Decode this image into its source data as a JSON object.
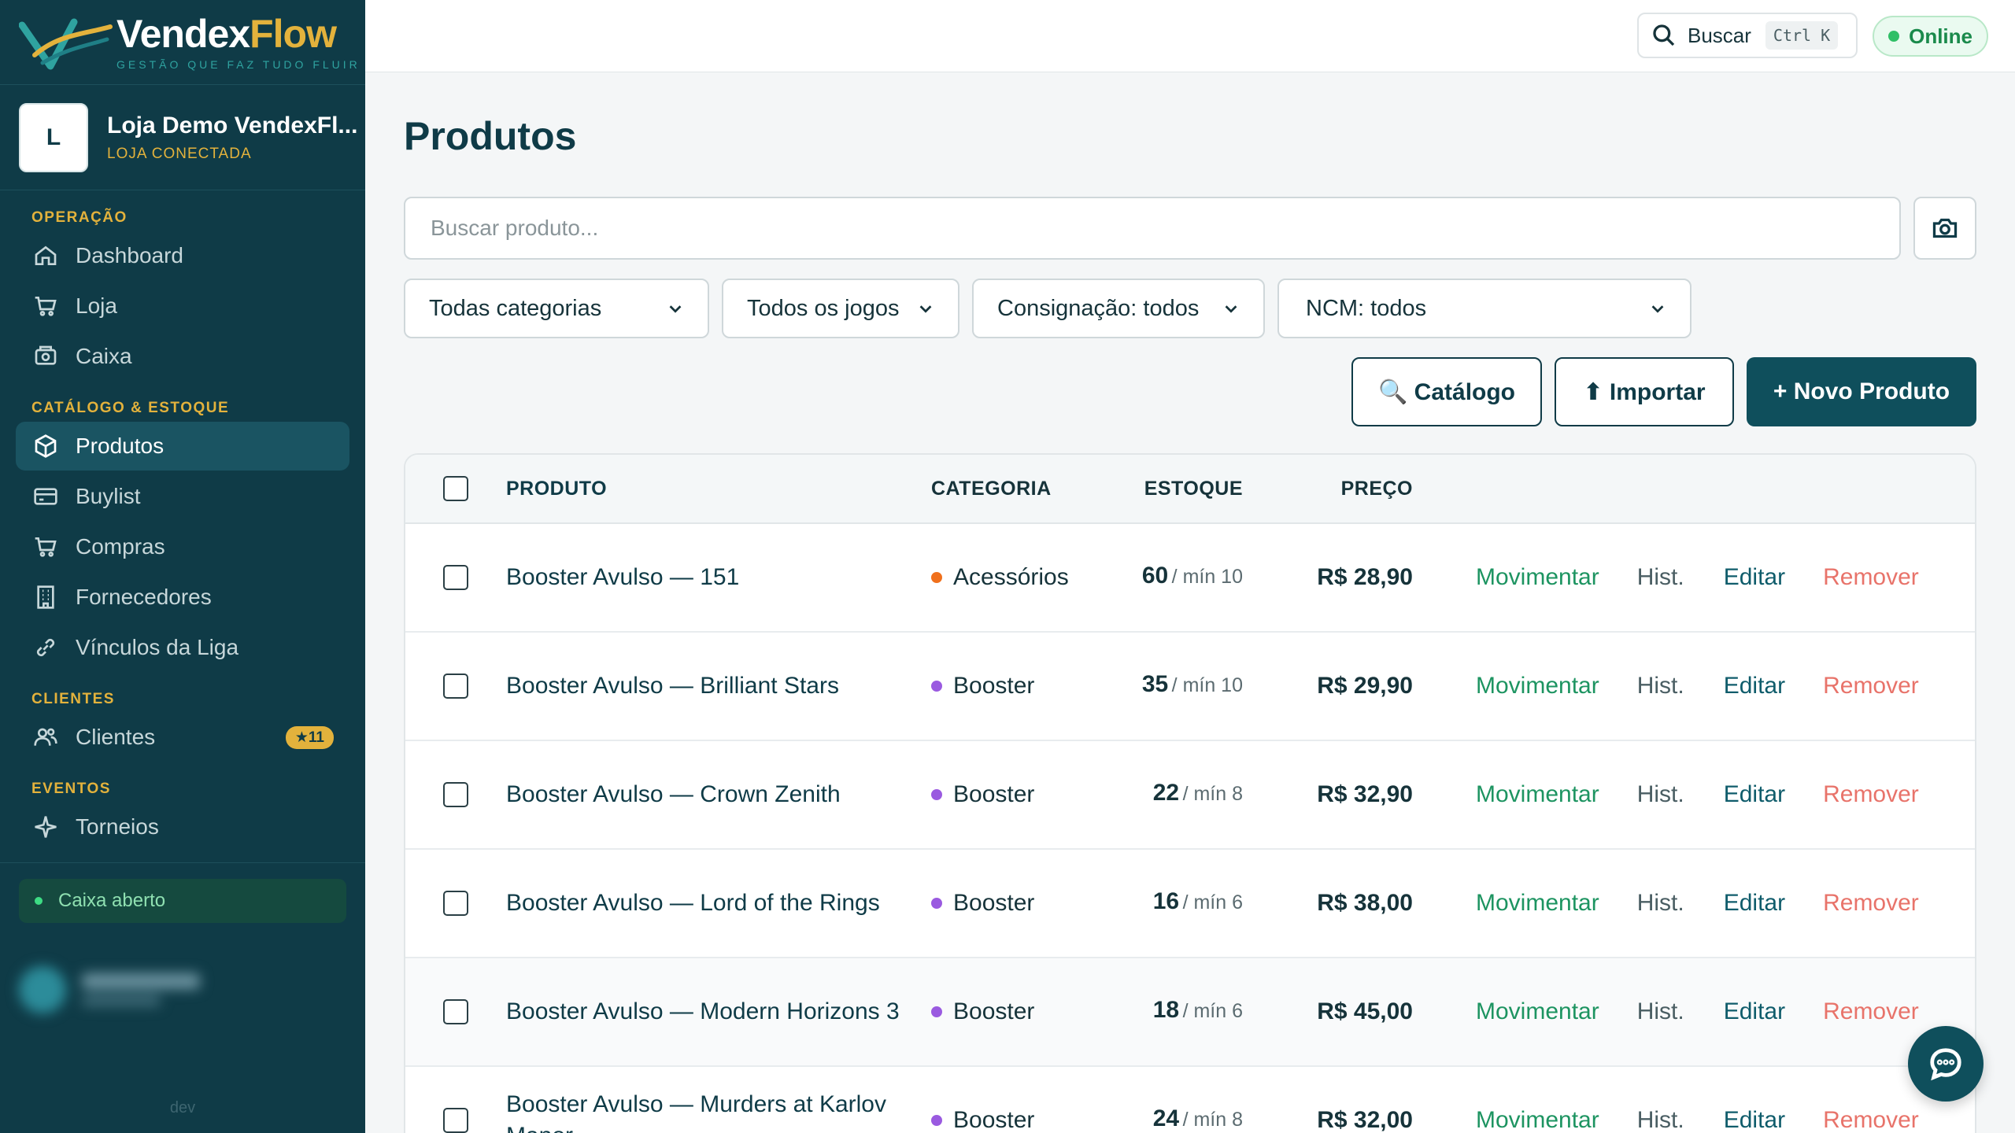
{
  "brand": {
    "name_part1": "Vendex",
    "name_part2": "Flow",
    "tagline": "GESTÃO QUE FAZ TUDO FLUIR"
  },
  "store": {
    "avatar_letter": "L",
    "name": "Loja Demo VendexFl...",
    "status": "LOJA CONECTADA"
  },
  "nav": {
    "sections": [
      {
        "title": "OPERAÇÃO",
        "items": [
          {
            "label": "Dashboard",
            "icon": "home-icon"
          },
          {
            "label": "Loja",
            "icon": "cart-icon"
          },
          {
            "label": "Caixa",
            "icon": "register-icon"
          }
        ]
      },
      {
        "title": "CATÁLOGO & ESTOQUE",
        "items": [
          {
            "label": "Produtos",
            "icon": "box-icon",
            "active": true
          },
          {
            "label": "Buylist",
            "icon": "card-icon"
          },
          {
            "label": "Compras",
            "icon": "cart-icon"
          },
          {
            "label": "Fornecedores",
            "icon": "building-icon"
          },
          {
            "label": "Vínculos da Liga",
            "icon": "link-icon"
          }
        ]
      },
      {
        "title": "CLIENTES",
        "items": [
          {
            "label": "Clientes",
            "icon": "users-icon",
            "badge": "★11"
          }
        ]
      },
      {
        "title": "EVENTOS",
        "items": [
          {
            "label": "Torneios",
            "icon": "sparkle-icon"
          }
        ]
      }
    ]
  },
  "cash_status": "Caixa aberto",
  "env_label": "dev",
  "topbar": {
    "search_label": "Buscar",
    "shortcut": "Ctrl K",
    "status": "Online"
  },
  "page": {
    "title": "Produtos",
    "search_placeholder": "Buscar produto...",
    "filters": [
      "Todas categorias",
      "Todos os jogos",
      "Consignação: todos",
      "NCM: todos"
    ],
    "buttons": {
      "catalog": "🔍 Catálogo",
      "import": "⬆ Importar",
      "new": "+ Novo Produto"
    }
  },
  "table": {
    "headers": {
      "product": "PRODUTO",
      "category": "CATEGORIA",
      "stock": "ESTOQUE",
      "price": "PREÇO"
    },
    "actions": {
      "move": "Movimentar",
      "hist": "Hist.",
      "edit": "Editar",
      "remove": "Remover"
    },
    "rows": [
      {
        "product": "Booster Avulso — 151",
        "category": "Acessórios",
        "cat_color": "#f0701c",
        "stock": "60",
        "min": "/ mín 10",
        "price": "R$ 28,90"
      },
      {
        "product": "Booster Avulso — Brilliant Stars",
        "category": "Booster",
        "cat_color": "#9a5ae0",
        "stock": "35",
        "min": "/ mín 10",
        "price": "R$ 29,90"
      },
      {
        "product": "Booster Avulso — Crown Zenith",
        "category": "Booster",
        "cat_color": "#9a5ae0",
        "stock": "22",
        "min": "/ mín 8",
        "price": "R$ 32,90"
      },
      {
        "product": "Booster Avulso — Lord of the Rings",
        "category": "Booster",
        "cat_color": "#9a5ae0",
        "stock": "16",
        "min": "/ mín 6",
        "price": "R$ 38,00"
      },
      {
        "product": "Booster Avulso — Modern Horizons 3",
        "category": "Booster",
        "cat_color": "#9a5ae0",
        "stock": "18",
        "min": "/ mín 6",
        "price": "R$ 45,00"
      },
      {
        "product": "Booster Avulso — Murders at Karlov Manor",
        "category": "Booster",
        "cat_color": "#9a5ae0",
        "stock": "24",
        "min": "/ mín 8",
        "price": "R$ 32,00"
      }
    ]
  }
}
